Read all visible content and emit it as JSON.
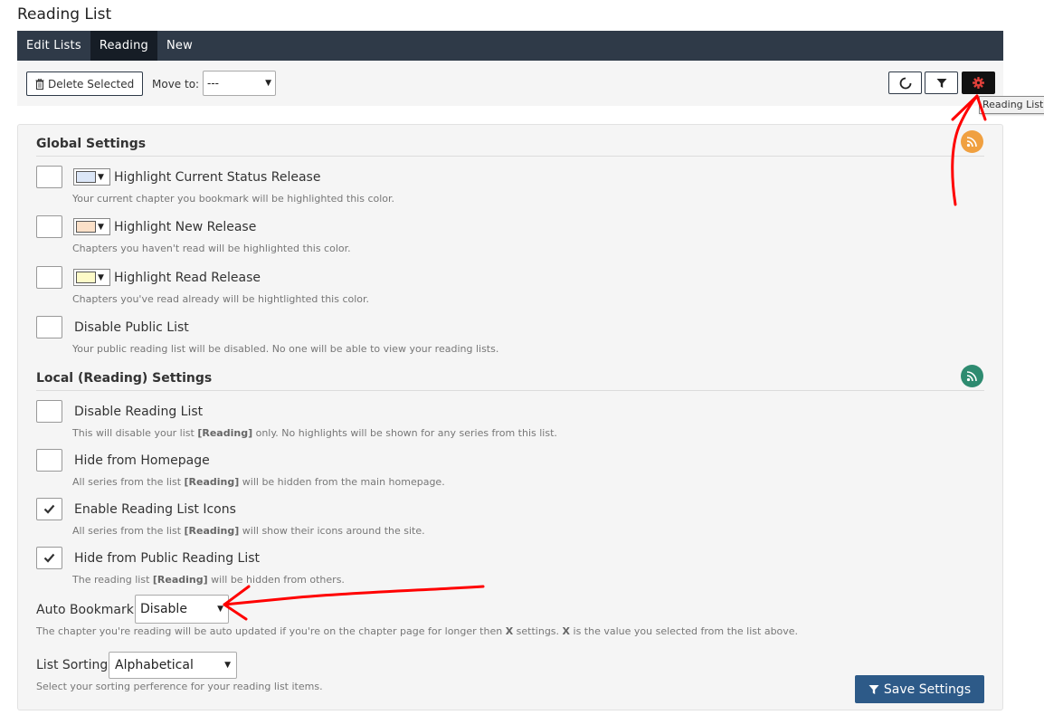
{
  "page": {
    "title": "Reading List"
  },
  "nav": {
    "tabs": [
      {
        "label": "Edit Lists",
        "active": false
      },
      {
        "label": "Reading",
        "active": true
      },
      {
        "label": "New",
        "active": false
      }
    ]
  },
  "toolbar": {
    "delete_label": "Delete Selected",
    "move_to_label": "Move to:",
    "move_to_value": "---",
    "tooltip": "Reading List",
    "icons": [
      "refresh-icon",
      "filter-icon",
      "gear-icon"
    ]
  },
  "global": {
    "title": "Global Settings",
    "rss_color": "#f0a040",
    "items": [
      {
        "label": "Highlight Current Status Release",
        "desc": "Your current chapter you bookmark will be highlighted this color.",
        "checked": false,
        "swatch": "#dbe6f7"
      },
      {
        "label": "Highlight New Release",
        "desc": "Chapters you haven't read will be highlighted this color.",
        "checked": false,
        "swatch": "#fbe0c8"
      },
      {
        "label": "Highlight Read Release",
        "desc": "Chapters you've read already will be hightlighted this color.",
        "checked": false,
        "swatch": "#fdfac8"
      },
      {
        "label": "Disable Public List",
        "desc": "Your public reading list will be disabled. No one will be able to view your reading lists.",
        "checked": false
      }
    ]
  },
  "local": {
    "title": "Local (Reading) Settings",
    "rss_color": "#2e8b70",
    "items": [
      {
        "label": "Disable Reading List",
        "desc_pre": "This will disable your list ",
        "desc_b": "[Reading]",
        "desc_post": " only. No highlights will be shown for any series from this list.",
        "checked": false
      },
      {
        "label": "Hide from Homepage",
        "desc_pre": "All series from the list ",
        "desc_b": "[Reading]",
        "desc_post": " will be hidden from the main homepage.",
        "checked": false
      },
      {
        "label": "Enable Reading List Icons",
        "desc_pre": "All series from the list ",
        "desc_b": "[Reading]",
        "desc_post": " will show their icons around the site.",
        "checked": true
      },
      {
        "label": "Hide from Public Reading List",
        "desc_pre": "The reading list ",
        "desc_b": "[Reading]",
        "desc_post": " will be hidden from others.",
        "checked": true
      }
    ]
  },
  "auto_bookmark": {
    "label": "Auto Bookmark:",
    "value": "Disable",
    "desc_a": "The chapter you're reading will be auto updated if you're on the chapter page for longer then ",
    "desc_x1": "X",
    "desc_b": " settings. ",
    "desc_x2": "X",
    "desc_c": " is the value you selected from the list above."
  },
  "list_sorting": {
    "label": "List Sorting:",
    "value": "Alphabetical",
    "desc": "Select your sorting perference for your reading list items."
  },
  "save_label": "Save Settings",
  "colors": {
    "navbar": "#2f3a48",
    "save": "#2d5a88",
    "annotation": "#ff0000"
  }
}
